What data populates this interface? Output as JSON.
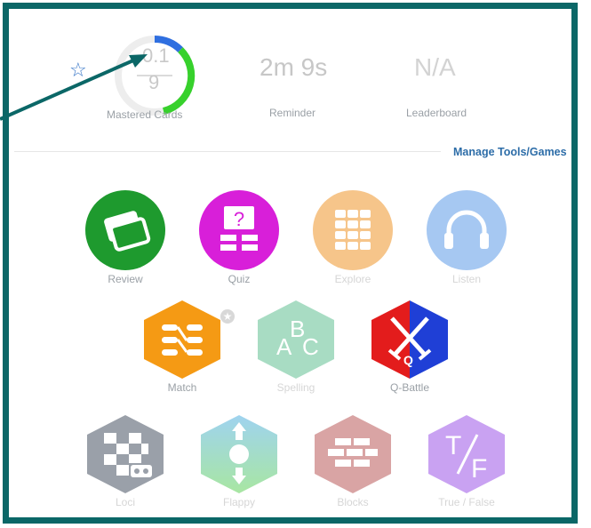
{
  "stats": {
    "mastered": {
      "numerator": "0.1",
      "denominator": "9",
      "label": "Mastered Cards"
    },
    "reminder": {
      "value": "2m 9s",
      "label": "Reminder"
    },
    "leaderboard": {
      "value": "N/A",
      "label": "Leaderboard"
    }
  },
  "manage_link": "Manage Tools/Games",
  "tools": [
    {
      "label": "Review",
      "icon": "cards-icon",
      "shape": "circle",
      "enabled": true
    },
    {
      "label": "Quiz",
      "icon": "quiz-icon",
      "shape": "circle",
      "enabled": true
    },
    {
      "label": "Explore",
      "icon": "grid-icon",
      "shape": "circle",
      "enabled": false
    },
    {
      "label": "Listen",
      "icon": "headphones-icon",
      "shape": "circle",
      "enabled": false
    },
    {
      "label": "Match",
      "icon": "match-icon",
      "shape": "hexagon",
      "enabled": true
    },
    {
      "label": "Spelling",
      "icon": "abc-icon",
      "shape": "hexagon",
      "enabled": false
    },
    {
      "label": "Q-Battle",
      "icon": "swords-icon",
      "shape": "hexagon",
      "enabled": true
    },
    {
      "label": "Loci",
      "icon": "vr-icon",
      "shape": "hexagon",
      "enabled": false
    },
    {
      "label": "Flappy",
      "icon": "flappy-icon",
      "shape": "hexagon",
      "enabled": false
    },
    {
      "label": "Blocks",
      "icon": "bricks-icon",
      "shape": "hexagon",
      "enabled": false
    },
    {
      "label": "True / False",
      "icon": "tf-icon",
      "shape": "hexagon",
      "enabled": false
    }
  ],
  "icon_text": {
    "quiz_mark": "?",
    "abc_a": "A",
    "abc_b": "B",
    "abc_c": "C",
    "battle_q": "Q",
    "tf_t": "T",
    "tf_f": "F"
  },
  "colors": {
    "frame": "#0b6767",
    "review": "#1e9a2e",
    "quiz": "#d81fd9",
    "explore": "#f6c58a",
    "listen": "#a6c8f2",
    "match": "#f59a14",
    "spelling": "#a8dcc3",
    "battle_red": "#e31c1c",
    "battle_blue": "#1f3fd6",
    "loci": "#9aa0a9",
    "flappy": "#a6e0a8",
    "blocks": "#d9a4a4",
    "truefalse": "#c9a2f2",
    "link": "#2d6da8",
    "progress_green": "#37d12c",
    "progress_blue": "#2f6fe0"
  }
}
